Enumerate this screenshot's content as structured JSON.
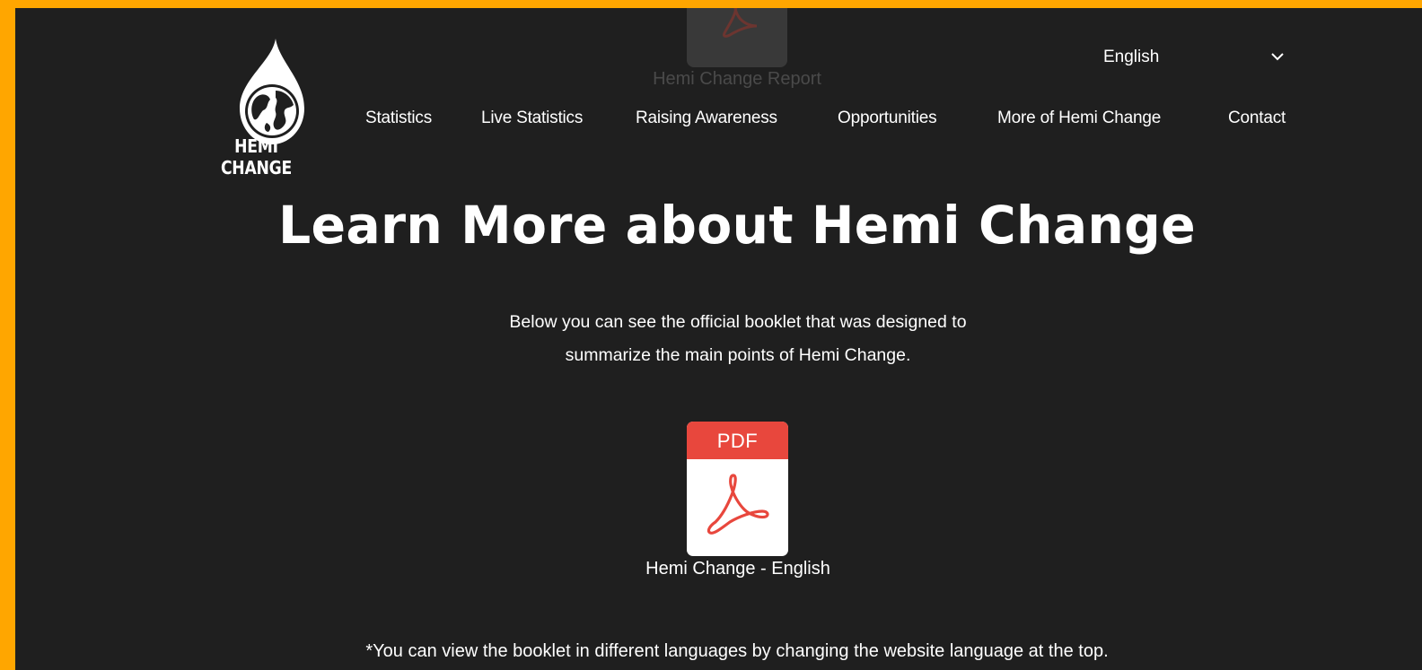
{
  "brand": {
    "name": "HEMI CHANGE"
  },
  "ghost_report": {
    "label": "Hemi Change Report",
    "icon": "pdf-acrobat-icon"
  },
  "language": {
    "selected": "English",
    "icon": "chevron-down-icon"
  },
  "nav": {
    "items": [
      {
        "label": "Statistics"
      },
      {
        "label": "Live Statistics"
      },
      {
        "label": "Raising Awareness"
      },
      {
        "label": "Opportunities"
      },
      {
        "label": "More of Hemi Change"
      },
      {
        "label": "Contact"
      }
    ]
  },
  "main": {
    "title": "Learn More about Hemi Change",
    "description_line1": "Below you can see the official booklet that was designed to",
    "description_line2": "summarize the main points of Hemi Change.",
    "pdf": {
      "badge": "PDF",
      "caption": "Hemi Change - English",
      "icon": "pdf-acrobat-icon"
    },
    "note": "*You can view the booklet in different languages by changing the website language at the top."
  },
  "colors": {
    "background": "#1f1f1f",
    "outer_border": "#FFA600",
    "pdf_red": "#E8473D"
  }
}
